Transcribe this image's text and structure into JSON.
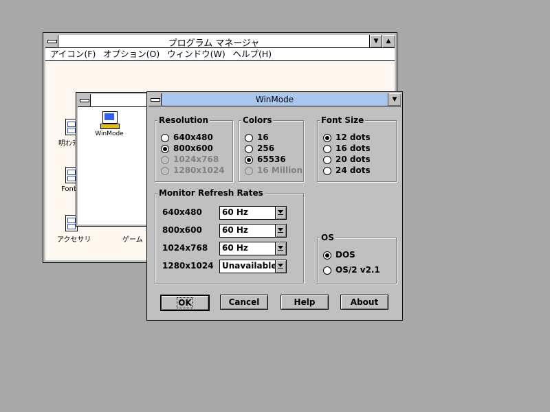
{
  "program_manager": {
    "title": "プログラム マネージャ",
    "min_glyph": "▼",
    "max_glyph": "▲",
    "menu": [
      "アイコン(F)",
      "オプション(O)",
      "ウィンドウ(W)",
      "ヘルプ(H)"
    ],
    "groups": [
      "明ｵﾝﾗ",
      "Font",
      "アクセサリ",
      "ゲーム"
    ]
  },
  "group_window": {
    "app_icon_label": "WinMode"
  },
  "dialog": {
    "title": "WinMode",
    "dropdown_glyph": "▼",
    "resolution": {
      "label": "Resolution",
      "options": [
        "640x480",
        "800x600",
        "1024x768",
        "1280x1024"
      ],
      "selected": "800x600",
      "disabled": [
        "1024x768",
        "1280x1024"
      ]
    },
    "colors": {
      "label": "Colors",
      "options": [
        "16",
        "256",
        "65536",
        "16 Million"
      ],
      "selected": "65536",
      "disabled": [
        "16 Million"
      ]
    },
    "font_size": {
      "label": "Font Size",
      "options": [
        "12 dots",
        "16 dots",
        "20 dots",
        "24 dots"
      ],
      "selected": "12 dots"
    },
    "refresh": {
      "label": "Monitor Refresh Rates",
      "rows": [
        {
          "mode": "640x480",
          "value": "60 Hz"
        },
        {
          "mode": "800x600",
          "value": "60 Hz"
        },
        {
          "mode": "1024x768",
          "value": "60 Hz"
        },
        {
          "mode": "1280x1024",
          "value": "Unavailable"
        }
      ]
    },
    "os": {
      "label": "OS",
      "options": [
        "DOS",
        "OS/2  v2.1"
      ],
      "selected": "DOS"
    },
    "buttons": {
      "ok": "OK",
      "cancel": "Cancel",
      "help": "Help",
      "about": "About"
    }
  }
}
